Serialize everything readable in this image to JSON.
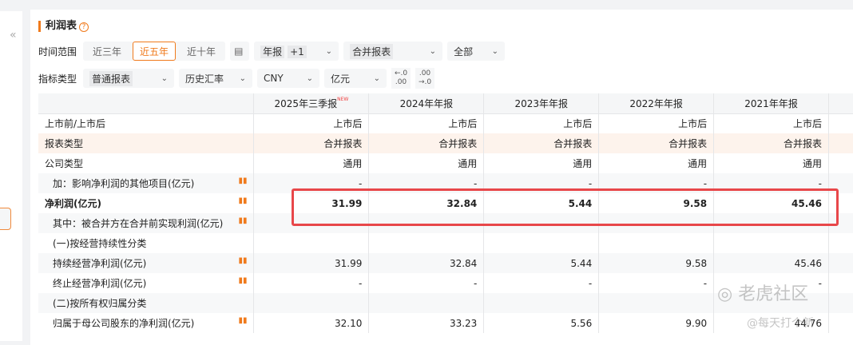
{
  "title": "利润表",
  "filters": {
    "time_label": "时间范围",
    "time_opts": [
      "近三年",
      "近五年",
      "近十年"
    ],
    "time_active": 1,
    "period": "年报",
    "period_extra": "+1",
    "report": "合并报表",
    "scope": "全部",
    "type_label": "指标类型",
    "type": "普通报表",
    "rate": "历史汇率",
    "currency": "CNY",
    "unit": "亿元",
    "dec_less": "←.0\n.00",
    "dec_more": ".00\n→.0"
  },
  "columns": [
    "2025年三季报",
    "2024年年报",
    "2023年年报",
    "2022年年报",
    "2021年年报"
  ],
  "new_badge": "NEW",
  "rows": [
    {
      "label": "上市前/上市后",
      "values": [
        "上市后",
        "上市后",
        "上市后",
        "上市后",
        "上市后"
      ]
    },
    {
      "label": "报表类型",
      "values": [
        "合并报表",
        "合并报表",
        "合并报表",
        "合并报表",
        "合并报表"
      ]
    },
    {
      "label": "公司类型",
      "values": [
        "通用",
        "通用",
        "通用",
        "通用",
        "通用"
      ]
    },
    {
      "label": "加：影响净利润的其他项目(亿元)",
      "values": [
        "-",
        "-",
        "-",
        "-",
        "-"
      ]
    },
    {
      "label": "净利润(亿元)",
      "values": [
        "31.99",
        "32.84",
        "5.44",
        "9.58",
        "45.46"
      ]
    },
    {
      "label": "其中：被合并方在合并前实现利润(亿元)",
      "values": [
        "",
        "",
        "",
        "",
        ""
      ]
    },
    {
      "label": "(一)按经营持续性分类",
      "values": [
        "",
        "",
        "",
        "",
        ""
      ]
    },
    {
      "label": "持续经营净利润(亿元)",
      "values": [
        "31.99",
        "32.84",
        "5.44",
        "9.58",
        "45.46"
      ]
    },
    {
      "label": "终止经营净利润(亿元)",
      "values": [
        "-",
        "-",
        "-",
        "-",
        "-"
      ]
    },
    {
      "label": "(二)按所有权归属分类",
      "values": [
        "",
        "",
        "",
        "",
        ""
      ]
    },
    {
      "label": "归属于母公司股东的净利润(亿元)",
      "values": [
        "32.10",
        "33.23",
        "5.56",
        "9.90",
        "44.76"
      ]
    }
  ],
  "watermark": {
    "brand": "老虎社区",
    "user": "@每天打个新"
  }
}
